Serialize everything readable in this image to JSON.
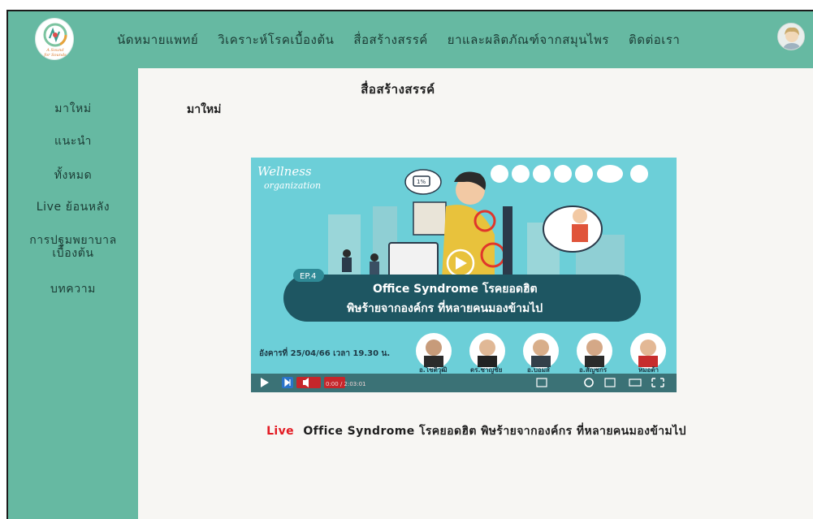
{
  "nav": {
    "items": [
      "นัดหมายแพทย์",
      "วิเคราะห์โรคเบื้องต้น",
      "สื่อสร้างสรรค์",
      "ยาและผลิตภัณฑ์จากสมุนไพร",
      "ติดต่อเรา"
    ]
  },
  "logo": {
    "line1": "A Sound",
    "line2": "for Sounds"
  },
  "sidebar": {
    "items": [
      "มาใหม่",
      "แนะนำ",
      "ทั้งหมด",
      "Live ย้อนหลัง",
      "การปฐมพยาบาล\nเบื้องต้น",
      "บทความ"
    ]
  },
  "main": {
    "page_title": "สื่อสร้างสรรค์",
    "section_title": "มาใหม่"
  },
  "video": {
    "brand_top": "Wellness",
    "brand_bottom": "organization",
    "episode": "EP.4",
    "headline_1": "Office Syndrome โรคยอดฮิต",
    "headline_2": "พิษร้ายจากองค์กร ที่หลายคนมองข้ามไป",
    "date_line": "อังคารที่ 25/04/66 เวลา 19.30 น.",
    "battery": "1%",
    "speakers": [
      "อ.โชติวุฒิ",
      "ดร.ชาญชัย",
      "อ.บอมส์",
      "อ.สัญชกร",
      "หมอต้า"
    ],
    "time": "0:00 / 2:03:01"
  },
  "card": {
    "live_label": "Live",
    "title": "Office Syndrome โรคยอดฮิต พิษร้ายจากองค์กร ที่หลายคนมองข้ามไป"
  },
  "colors": {
    "teal": "#66b9a2",
    "content_bg": "#f7f6f3",
    "live_red": "#e31b23",
    "video_bg": "#6ccfd8"
  }
}
